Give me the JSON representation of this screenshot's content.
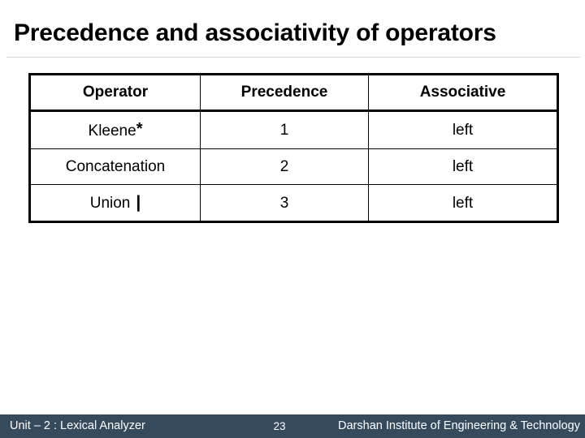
{
  "slide": {
    "title": "Precedence and associativity of operators"
  },
  "table": {
    "headers": [
      "Operator",
      "Precedence",
      "Associative"
    ],
    "rows": [
      {
        "operator": "Kleene",
        "operator_symbol": "*",
        "precedence": "1",
        "associative": "left"
      },
      {
        "operator": "Concatenation",
        "operator_symbol": "",
        "precedence": "2",
        "associative": "left"
      },
      {
        "operator": "Union",
        "operator_symbol": "|",
        "precedence": "3",
        "associative": "left"
      }
    ]
  },
  "footer": {
    "unit": "Unit – 2 : Lexical Analyzer",
    "page_number": "23",
    "institute": "Darshan Institute of Engineering & Technology",
    "background_color": "#364a5e",
    "text_color": "#ffffff"
  }
}
